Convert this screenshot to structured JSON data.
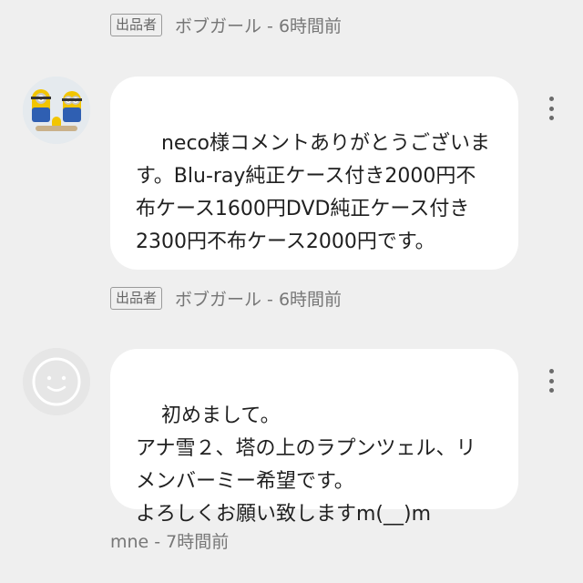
{
  "comments_top": {
    "meta": {
      "badge": "出品者",
      "author_time": "ボブガール - 6時間前"
    }
  },
  "comment_1": {
    "avatar": "minion-photo-avatar",
    "text": "neco様コメントありがとうございます。Blu-ray純正ケース付き2000円不布ケース1600円DVD純正ケース付き2300円不布ケース2000円です。",
    "meta": {
      "badge": "出品者",
      "author_time": "ボブガール - 6時間前"
    },
    "menu_icon": "more-vert-icon"
  },
  "comment_2": {
    "avatar": "default-smiley-avatar",
    "text": "初めまして。\nアナ雪２、塔の上のラプンツェル、リメンバーミー希望です。\nよろしくお願い致しますm(__)m",
    "meta": {
      "author_time": "mne - 7時間前"
    },
    "menu_icon": "more-vert-icon"
  },
  "colors": {
    "background": "#efefef",
    "bubble": "#ffffff",
    "meta_text": "#777777"
  }
}
